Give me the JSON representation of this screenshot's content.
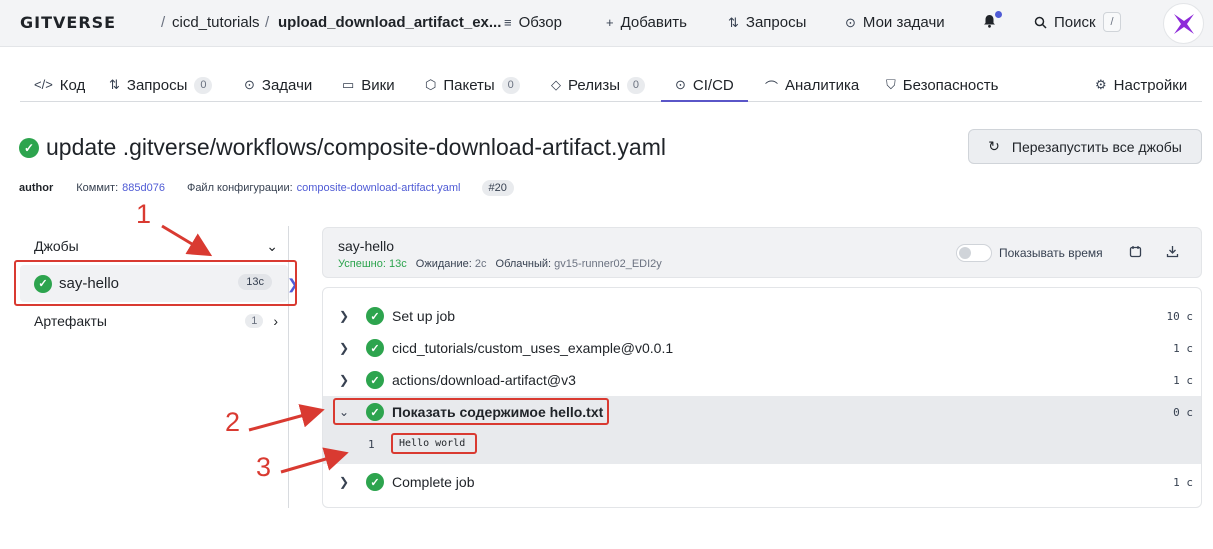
{
  "topbar": {
    "logo": "GITVERSE",
    "breadcrumb": {
      "owner": "cicd_tutorials",
      "sep": "/",
      "repo": "upload_download_artifact_ex..."
    },
    "nav": [
      {
        "icon": "overview-icon",
        "glyph": "≡",
        "label": "Обзор"
      },
      {
        "icon": "plus-icon",
        "glyph": "+",
        "label": "Добавить"
      },
      {
        "icon": "pull-request-icon",
        "glyph": "⇅",
        "label": "Запросы"
      },
      {
        "icon": "task-icon",
        "glyph": "⊙",
        "label": "Мои задачи"
      }
    ],
    "search_label": "Поиск",
    "search_shortcut": "/",
    "accent": "#4f5bd5"
  },
  "tabs": [
    {
      "label": "Код",
      "glyph": "</>",
      "count": ""
    },
    {
      "label": "Запросы",
      "glyph": "⇅",
      "count": "0"
    },
    {
      "label": "Задачи",
      "glyph": "⊙",
      "count": ""
    },
    {
      "label": "Вики",
      "glyph": "▭",
      "count": ""
    },
    {
      "label": "Пакеты",
      "glyph": "⬡",
      "count": "0"
    },
    {
      "label": "Релизы",
      "glyph": "◇",
      "count": "0"
    },
    {
      "label": "CI/CD",
      "glyph": "⊙",
      "count": "",
      "active": true
    },
    {
      "label": "Аналитика",
      "glyph": "⌒",
      "count": ""
    },
    {
      "label": "Безопасность",
      "glyph": "⛉",
      "count": ""
    },
    {
      "label": "Настройки",
      "glyph": "⚙",
      "count": ""
    }
  ],
  "run": {
    "title": "update .gitverse/workflows/composite-download-artifact.yaml",
    "rerun_label": "Перезапустить все джобы",
    "author": "author",
    "commit_label": "Коммит:",
    "commit_sha": "885d076",
    "config_label": "Файл конфигурации:",
    "config_file": "composite-download-artifact.yaml",
    "run_number": "#20"
  },
  "sidebar": {
    "jobs_heading": "Джобы",
    "jobs": [
      {
        "name": "say-hello",
        "duration": "13с"
      }
    ],
    "artifacts_heading": "Артефакты",
    "artifacts_count": "1"
  },
  "job": {
    "name": "say-hello",
    "status_label": "Успешно:",
    "status_value": "13с",
    "wait_label": "Ожидание:",
    "wait_value": "2с",
    "runner_label": "Облачный:",
    "runner_value": "gv15-runner02_EDI2y",
    "show_time_label": "Показывать время"
  },
  "steps": [
    {
      "title": "Set up job",
      "time": "10 с",
      "expanded": false
    },
    {
      "title": "cicd_tutorials/custom_uses_example@v0.0.1",
      "time": "1 с",
      "expanded": false
    },
    {
      "title": "actions/download-artifact@v3",
      "time": "1 с",
      "expanded": false
    },
    {
      "title": "Показать содержимое hello.txt",
      "time": "0 с",
      "expanded": true
    },
    {
      "title": "Complete job",
      "time": "1 с",
      "expanded": false
    }
  ],
  "log": {
    "line_no": "1",
    "text": "Hello world"
  },
  "annotations": {
    "n1": "1",
    "n2": "2",
    "n3": "3",
    "color": "#d93a31"
  }
}
